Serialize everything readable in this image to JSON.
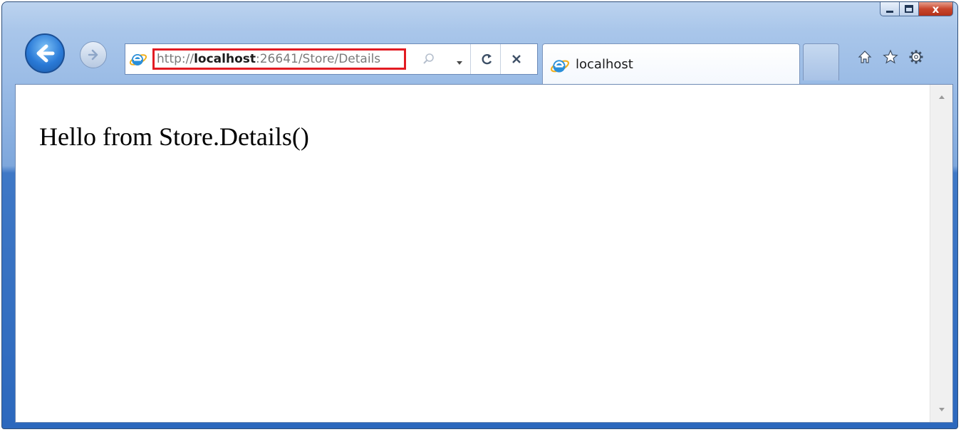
{
  "window": {
    "controls": {
      "minimize_icon": "minimize-icon",
      "maximize_icon": "maximize-icon",
      "close_icon": "close-icon",
      "close_label": "x"
    }
  },
  "navigation": {
    "back_icon": "arrow-left-icon",
    "forward_icon": "arrow-right-icon"
  },
  "address_bar": {
    "url_prefix": "http://",
    "url_host": "localhost",
    "url_rest": ":26641/Store/Details",
    "highlight_color": "#e21b22",
    "search_icon": "search-icon",
    "dropdown_icon": "chevron-down-icon",
    "refresh_icon": "refresh-icon",
    "stop_icon": "close-icon"
  },
  "tab": {
    "title": "localhost",
    "icon": "ie-logo-icon"
  },
  "command_bar": {
    "home_icon": "home-icon",
    "favorites_icon": "star-icon",
    "tools_icon": "gear-icon"
  },
  "page": {
    "body_text": "Hello from Store.Details()"
  }
}
